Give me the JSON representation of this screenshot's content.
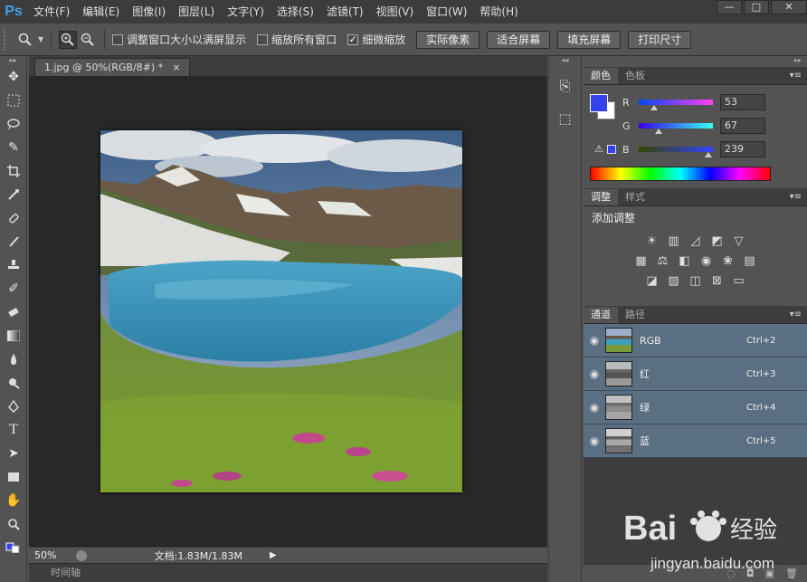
{
  "app": {
    "logo": "Ps"
  },
  "menubar": {
    "items": [
      "文件(F)",
      "编辑(E)",
      "图像(I)",
      "图层(L)",
      "文字(Y)",
      "选择(S)",
      "滤镜(T)",
      "视图(V)",
      "窗口(W)",
      "帮助(H)"
    ]
  },
  "window_controls": {
    "minimize": "—",
    "maximize": "□",
    "close": "✕"
  },
  "options": {
    "checkboxes": [
      {
        "label": "调整窗口大小以满屏显示",
        "checked": false
      },
      {
        "label": "缩放所有窗口",
        "checked": false
      },
      {
        "label": "细微缩放",
        "checked": true
      }
    ],
    "buttons": [
      "实际像素",
      "适合屏幕",
      "填充屏幕",
      "打印尺寸"
    ]
  },
  "document": {
    "tab_title": "1.jpg @ 50%(RGB/8#) *",
    "tab_close": "×",
    "zoom": "50%",
    "doc_info": "文档:1.83M/1.83M"
  },
  "timeline": {
    "label": "时间轴"
  },
  "panels": {
    "color": {
      "tabs": [
        "颜色",
        "色板"
      ],
      "channels": [
        {
          "label": "R",
          "value": "53",
          "fraction": 0.208,
          "grad": "linear-gradient(to right,#0043ef,#ff43ef)"
        },
        {
          "label": "G",
          "value": "67",
          "fraction": 0.263,
          "grad": "linear-gradient(to right,#3500ef,#35ffef)"
        },
        {
          "label": "B",
          "value": "239",
          "fraction": 0.937,
          "grad": "linear-gradient(to right,#354300,#3543ff)"
        }
      ],
      "foreground": "#3543ef",
      "background": "#ffffff"
    },
    "adjustments": {
      "tabs": [
        "调整",
        "样式"
      ],
      "title": "添加调整"
    },
    "channels": {
      "tabs": [
        "通道",
        "路径"
      ],
      "items": [
        {
          "name": "RGB",
          "shortcut": "Ctrl+2"
        },
        {
          "name": "红",
          "shortcut": "Ctrl+3"
        },
        {
          "name": "绿",
          "shortcut": "Ctrl+4"
        },
        {
          "name": "蓝",
          "shortcut": "Ctrl+5"
        }
      ]
    }
  },
  "watermark": {
    "brand": "Bai",
    "brand2": "经验",
    "url": "jingyan.baidu.com"
  }
}
